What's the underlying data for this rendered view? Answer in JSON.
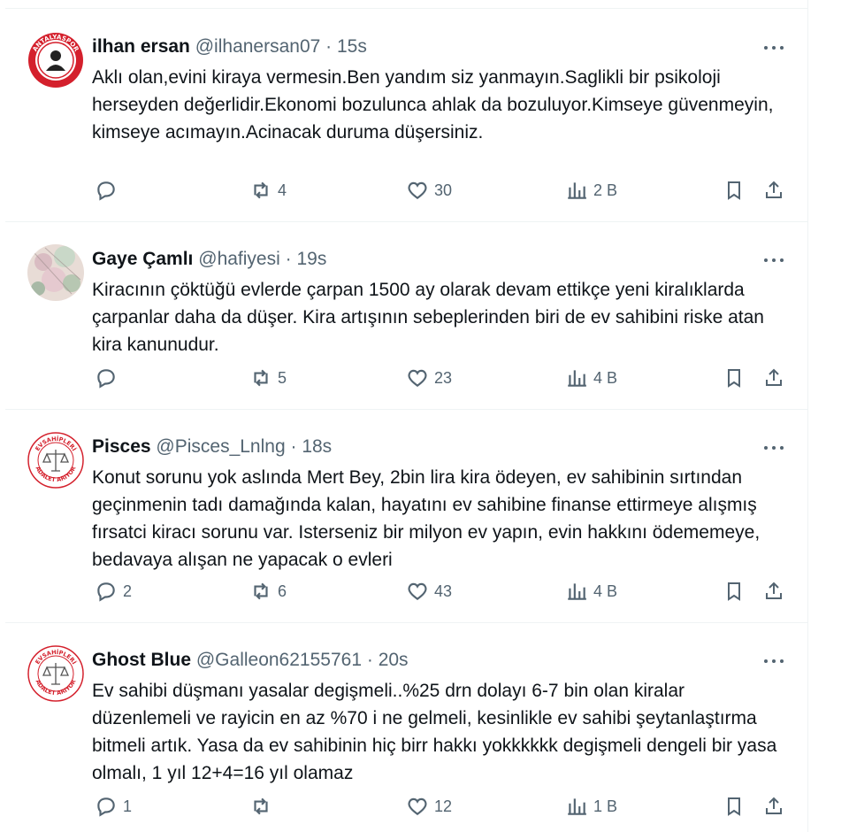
{
  "tweets": [
    {
      "name": "ilhan ersan",
      "handle": "@ilhanersan07",
      "time": "15s",
      "text": "Aklı olan,evini kiraya vermesin.Ben yandım siz yanmayın.Saglikli bir psikoloji herseyden değerlidir.Ekonomi bozulunca ahlak da bozuluyor.Kimseye güvenmeyin, kimseye acımayın.Acinacak duruma düşersiniz.",
      "replies": "",
      "reposts": "4",
      "likes": "30",
      "views": "2 B",
      "avatar_text": "ANTALYASPOR"
    },
    {
      "name": "Gaye Çamlı",
      "handle": "@hafiyesi",
      "time": "19s",
      "text": "Kiracının çöktüğü evlerde çarpan 1500 ay olarak devam ettikçe yeni kiralıklarda çarpanlar daha da düşer. Kira artışının sebeplerinden biri de ev sahibini riske atan kira kanunudur.",
      "replies": "",
      "reposts": "5",
      "likes": "23",
      "views": "4 B"
    },
    {
      "name": "Pisces",
      "handle": "@Pisces_Lnlng",
      "time": "18s",
      "text": "Konut sorunu yok aslında Mert Bey, 2bin lira kira ödeyen, ev sahibinin sırtından geçinmenin tadı damağında kalan, hayatını ev sahibine finanse ettirmeye alışmış fırsatci kiracı sorunu var. Isterseniz bir milyon ev yapın, evin hakkını ödememeye, bedavaya alışan ne yapacak o evleri",
      "replies": "2",
      "reposts": "6",
      "likes": "43",
      "views": "4 B",
      "avatar_text_top": "EVSAHİPLERİ",
      "avatar_text_bottom": "ADALET ARIYOR"
    },
    {
      "name": "Ghost Blue",
      "handle": "@Galleon62155761",
      "time": "20s",
      "text": "Ev sahibi düşmanı yasalar degişmeli..%25 drn dolayı  6-7 bin olan kiralar düzenlemeli ve  rayicin en az %70 i ne gelmeli, kesinlikle ev sahibi şeytanlaştırma bitmeli artık.  Yasa da ev sahibinin hiç birr hakkı yokkkkkk degişmeli dengeli bir yasa olmalı, 1 yıl 12+4=16 yıl olamaz",
      "replies": "1",
      "reposts": "",
      "likes": "12",
      "views": "1 B",
      "avatar_text_top": "EVSAHİPLERİ",
      "avatar_text_bottom": "ADALET ARIYOR"
    }
  ],
  "separator": "·",
  "colors": {
    "text": "#0f1419",
    "secondary": "#536471",
    "border": "#eff3f4",
    "seal_red": "#d4202c"
  },
  "icons": [
    "reply-icon",
    "repost-icon",
    "like-icon",
    "views-icon",
    "bookmark-icon",
    "share-icon",
    "more-icon"
  ]
}
